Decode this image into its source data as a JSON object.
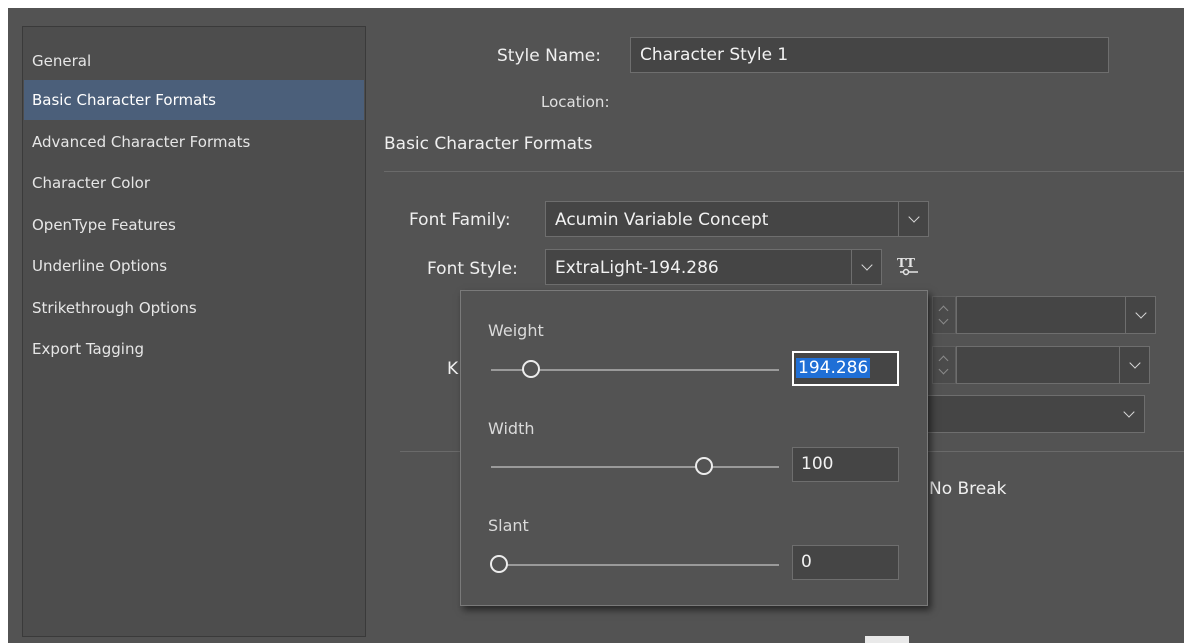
{
  "sidebar": {
    "items": [
      {
        "label": "General"
      },
      {
        "label": "Basic Character Formats",
        "selected": true
      },
      {
        "label": "Advanced Character Formats"
      },
      {
        "label": "Character Color"
      },
      {
        "label": "OpenType Features"
      },
      {
        "label": "Underline Options"
      },
      {
        "label": "Strikethrough Options"
      },
      {
        "label": "Export Tagging"
      }
    ]
  },
  "header": {
    "style_name_label": "Style Name:",
    "style_name_value": "Character Style 1",
    "location_label": "Location:"
  },
  "section": {
    "title": "Basic Character Formats",
    "font_family_label": "Font Family:",
    "font_family_value": "Acumin Variable Concept",
    "font_style_label": "Font Style:",
    "font_style_value": "ExtraLight-194.286",
    "partial_label": "K",
    "no_break_label": "No Break"
  },
  "variable_font_popup": {
    "weight_label": "Weight",
    "weight_value": "194.286",
    "width_label": "Width",
    "width_value": "100",
    "slant_label": "Slant",
    "slant_value": "0"
  },
  "icons": {
    "variable_font": "variable-font-icon",
    "dropdown": "chevron-down-icon"
  },
  "colors": {
    "selection": "#4b5f7a",
    "text_highlight": "#1f6fd6",
    "panel": "#535353"
  }
}
